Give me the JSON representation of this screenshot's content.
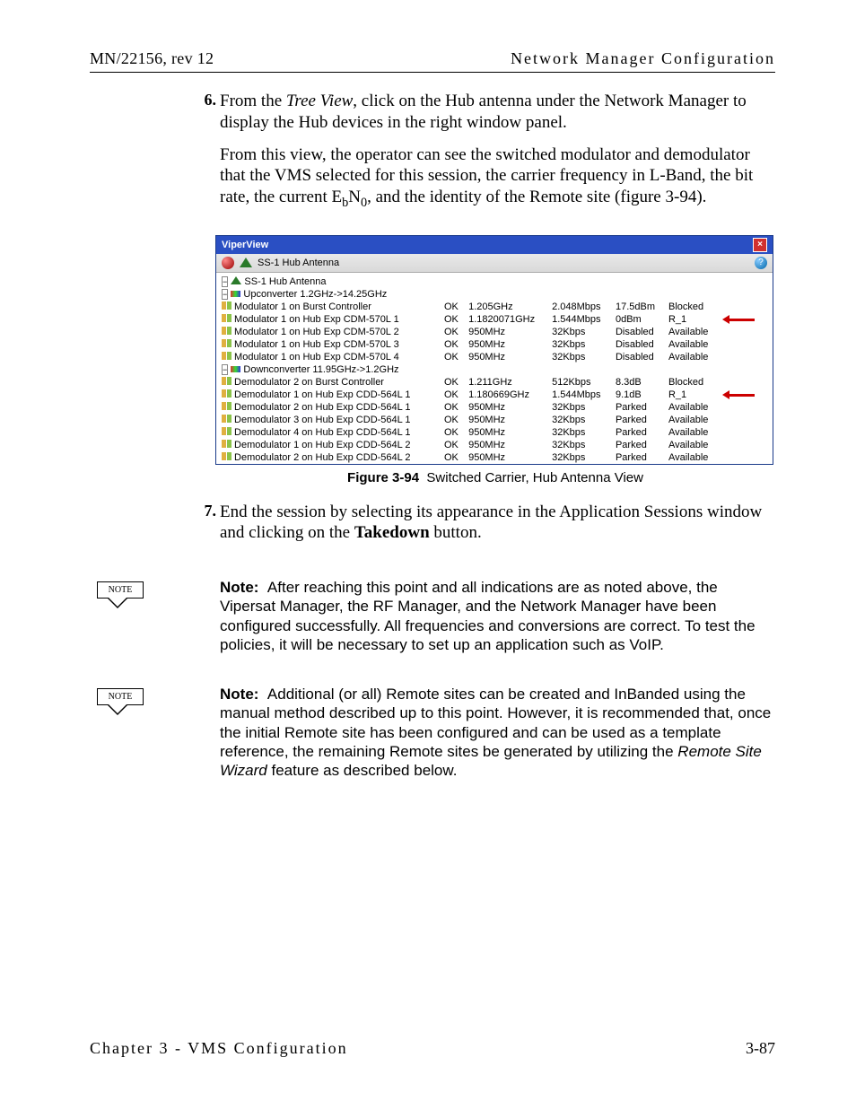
{
  "header": {
    "left": "MN/22156, rev 12",
    "right": "Network Manager Configuration"
  },
  "steps": {
    "s6": {
      "num": "6.",
      "p1a": "From the ",
      "p1b": "Tree View",
      "p1c": ", click on the Hub antenna under the Network Manager to display the Hub devices in the right window panel.",
      "p2": "From this view, the operator can see the switched modulator and demodulator that the VMS selected for this session, the carrier frequency in L-Band, the bit rate, the current E",
      "p2b": "b",
      "p2c": "N",
      "p2d": "0",
      "p2e": ", and the identity of the Remote site (figure 3-94)."
    },
    "s7": {
      "num": "7.",
      "p1": "End the session by selecting its appearance in the Application Sessions window and clicking on the ",
      "p1b": "Takedown",
      "p1c": " button."
    }
  },
  "vv": {
    "title": "ViperView",
    "addr": "SS-1 Hub Antenna",
    "root": "SS-1 Hub Antenna",
    "upconv": "Upconverter 1.2GHz->14.25GHz",
    "downconv": "Downconverter 11.95GHz->1.2GHz",
    "up_rows": [
      [
        "Modulator 1 on Burst Controller",
        "OK",
        "1.205GHz",
        "2.048Mbps",
        "17.5dBm",
        "Blocked",
        false
      ],
      [
        "Modulator 1 on Hub Exp CDM-570L 1",
        "OK",
        "1.1820071GHz",
        "1.544Mbps",
        "0dBm",
        "R_1",
        true
      ],
      [
        "Modulator 1 on Hub Exp CDM-570L 2",
        "OK",
        "950MHz",
        "32Kbps",
        "Disabled",
        "Available",
        false
      ],
      [
        "Modulator 1 on Hub Exp CDM-570L 3",
        "OK",
        "950MHz",
        "32Kbps",
        "Disabled",
        "Available",
        false
      ],
      [
        "Modulator 1 on Hub Exp CDM-570L 4",
        "OK",
        "950MHz",
        "32Kbps",
        "Disabled",
        "Available",
        false
      ]
    ],
    "down_rows": [
      [
        "Demodulator 2 on Burst Controller",
        "OK",
        "1.211GHz",
        "512Kbps",
        "8.3dB",
        "Blocked",
        false
      ],
      [
        "Demodulator 1 on Hub Exp CDD-564L 1",
        "OK",
        "1.180669GHz",
        "1.544Mbps",
        "9.1dB",
        "R_1",
        true
      ],
      [
        "Demodulator 2 on Hub Exp CDD-564L 1",
        "OK",
        "950MHz",
        "32Kbps",
        "Parked",
        "Available",
        false
      ],
      [
        "Demodulator 3 on Hub Exp CDD-564L 1",
        "OK",
        "950MHz",
        "32Kbps",
        "Parked",
        "Available",
        false
      ],
      [
        "Demodulator 4 on Hub Exp CDD-564L 1",
        "OK",
        "950MHz",
        "32Kbps",
        "Parked",
        "Available",
        false
      ],
      [
        "Demodulator 1 on Hub Exp CDD-564L 2",
        "OK",
        "950MHz",
        "32Kbps",
        "Parked",
        "Available",
        false
      ],
      [
        "Demodulator 2 on Hub Exp CDD-564L 2",
        "OK",
        "950MHz",
        "32Kbps",
        "Parked",
        "Available",
        false
      ]
    ]
  },
  "caption": {
    "label": "Figure 3-94",
    "text": "Switched Carrier, Hub Antenna View"
  },
  "notes": {
    "flag": "NOTE",
    "n1_label": "Note:",
    "n1": "After reaching this point and all indications are as noted above, the Vipersat Manager, the RF Manager, and the Network Manager have been configured successfully. All frequencies and conversions are correct. To test the policies, it will be necessary to set up an application such as VoIP.",
    "n2_label": "Note:",
    "n2a": "Additional (or all) Remote sites can be created and InBanded using the manual method described up to this point. However, it is recommended that, once the initial Remote site has been configured and can be used as a template reference, the remaining Remote sites be generated by utilizing the ",
    "n2b": "Remote Site Wizard",
    "n2c": " feature as described below."
  },
  "footer": {
    "left": "Chapter 3 - VMS Configuration",
    "right": "3-87"
  }
}
